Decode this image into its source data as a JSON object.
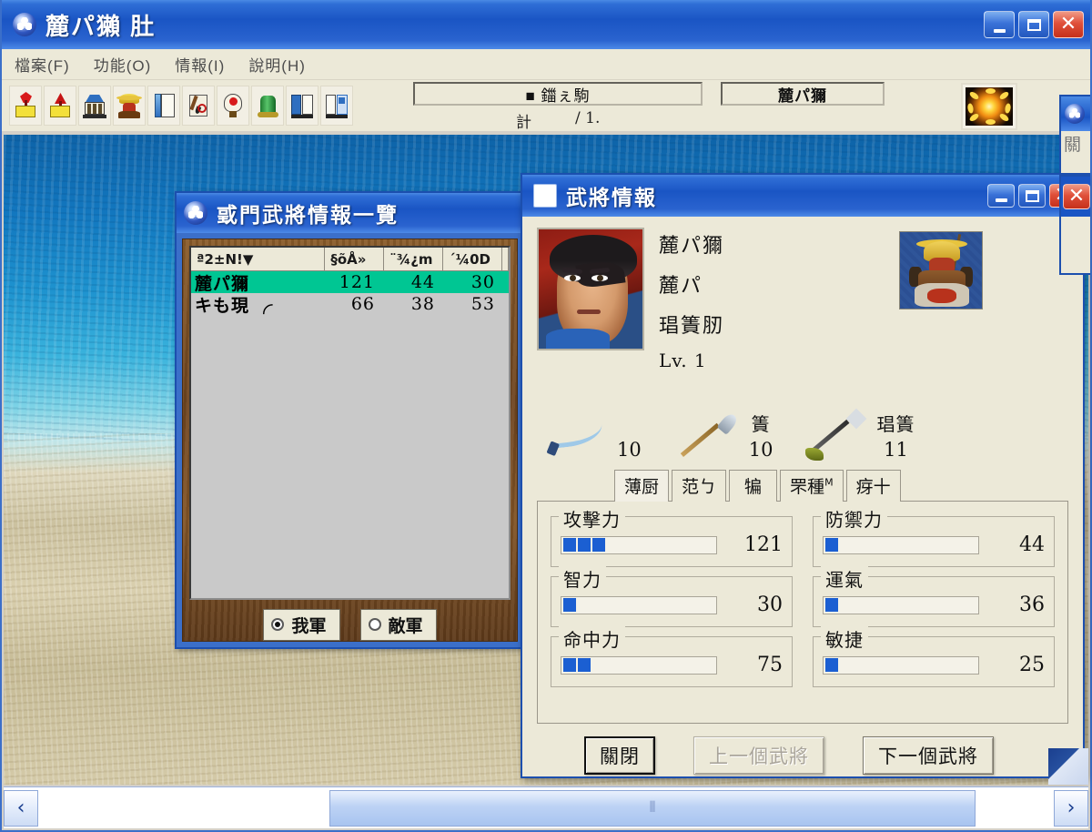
{
  "app": {
    "title": "麓パ獺  肚",
    "menu": [
      {
        "label": "檔案(F)"
      },
      {
        "label": "功能(O)"
      },
      {
        "label": "情報(I)"
      },
      {
        "label": "說明(H)"
      }
    ],
    "toolbar_icons": [
      "red-flag-yellow-base-icon",
      "red-pennant-yellow-base-icon",
      "blue-roof-building-icon",
      "gold-helmet-general-icon",
      "blue-scroll-document-icon",
      "brush-writing-icon",
      "red-dot-balloon-icon",
      "green-cylinder-icon",
      "two-blue-flags-icon",
      "two-blue-books-icon"
    ],
    "status_field_1": "■ 鍿ぇ駒",
    "status_calc_label": "計",
    "status_calc_value": "/ 1.",
    "status_field_2": "麓パ獮",
    "sun_icon": "sun-icon"
  },
  "list_window": {
    "title": "戜門武將情報一覽",
    "columns": [
      "ª2±N!▼",
      "§õÅ»",
      "¨¾¿m",
      "´¼0D",
      ""
    ],
    "rows": [
      {
        "name": "麓パ獮",
        "v1": "121",
        "v2": "44",
        "v3": "30",
        "selected": true
      },
      {
        "name": "キも現 ╭",
        "v1": "66",
        "v2": "38",
        "v3": "53",
        "selected": false
      }
    ],
    "radios": [
      {
        "label": "我軍",
        "checked": true
      },
      {
        "label": "敵軍",
        "checked": false
      }
    ]
  },
  "detail_window": {
    "title": "武將情報",
    "portrait": "character-portrait",
    "unit_sprite": "cavalry-unit-sprite",
    "bio": {
      "name": "麓パ獮",
      "surname": "麓パ",
      "rank": "琩簀肕",
      "level": "Lv. 1"
    },
    "weapons": [
      {
        "icon": "sword-icon",
        "label": "",
        "value": "10"
      },
      {
        "icon": "spear-icon",
        "label": "簀",
        "value": "10"
      },
      {
        "icon": "halberd-icon",
        "label": "琩簀",
        "value": "11"
      }
    ],
    "tabs": [
      {
        "label": "薄厨",
        "sup": "",
        "active": true
      },
      {
        "label": "范ㄅ",
        "sup": "",
        "active": false
      },
      {
        "label": "犏",
        "sup": "",
        "active": false
      },
      {
        "label": "罘種",
        "sup": "M",
        "active": false
      },
      {
        "label": "疨十",
        "sup": "",
        "active": false
      }
    ],
    "stats": [
      {
        "label": "攻擊力",
        "value": "121",
        "blocks": 3
      },
      {
        "label": "防禦力",
        "value": "44",
        "blocks": 1
      },
      {
        "label": "智力",
        "value": "30",
        "blocks": 1
      },
      {
        "label": "運氣",
        "value": "36",
        "blocks": 1
      },
      {
        "label": "命中力",
        "value": "75",
        "blocks": 2
      },
      {
        "label": "敏捷",
        "value": "25",
        "blocks": 1
      }
    ],
    "buttons": [
      {
        "label": "關閉",
        "state": "focused"
      },
      {
        "label": "上一個武將",
        "state": "disabled"
      },
      {
        "label": "下一個武將",
        "state": "normal"
      }
    ]
  },
  "side_window": {
    "title_icon": "app-globe-icon",
    "body_text": "關"
  },
  "scrollbar": {
    "left_arrow": "‹",
    "right_arrow": "›",
    "thumb_grip": "⦀"
  },
  "colors": {
    "titlebar_blue": "#1a55c4",
    "selection_green": "#00c693",
    "bar_blue": "#1b5fd2",
    "panel_beige": "#ece9d8"
  }
}
